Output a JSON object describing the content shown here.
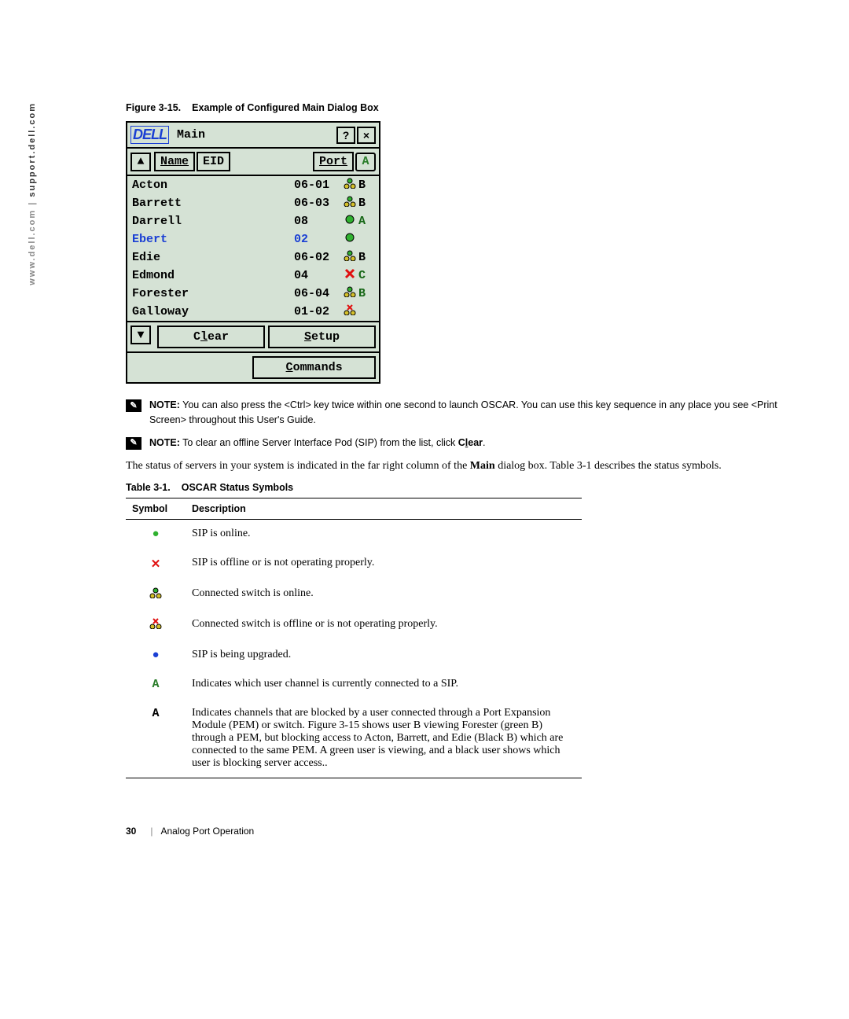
{
  "side_text_light": "www.dell.com | ",
  "side_text_dark": "support.dell.com",
  "fig_caption_num": "Figure 3-15.",
  "fig_caption_text": "Example of Configured Main Dialog Box",
  "dialog": {
    "logo": "DELL",
    "title": "Main",
    "help": "?",
    "close": "×",
    "hdr_name": "Name",
    "hdr_eid": "EID",
    "hdr_port": "Port",
    "hdr_a": "A",
    "rows": [
      {
        "name": "Acton",
        "port": "06-01",
        "icon": "switch-online",
        "icolor": "yellow",
        "ch": "B",
        "chcolor": "black"
      },
      {
        "name": "Barrett",
        "port": "06-03",
        "icon": "switch-online",
        "icolor": "yellow",
        "ch": "B",
        "chcolor": "black"
      },
      {
        "name": "Darrell",
        "port": "08",
        "icon": "circle",
        "icolor": "green",
        "ch": "A",
        "chcolor": "darkgreen"
      },
      {
        "name": "Ebert",
        "port": "02",
        "icon": "circle",
        "icolor": "green",
        "ch": "",
        "chcolor": "",
        "bold": true
      },
      {
        "name": "Edie",
        "port": "06-02",
        "icon": "switch-online",
        "icolor": "yellow",
        "ch": "B",
        "chcolor": "black"
      },
      {
        "name": "Edmond",
        "port": "04",
        "icon": "x",
        "icolor": "red",
        "ch": "C",
        "chcolor": "darkgreen"
      },
      {
        "name": "Forester",
        "port": "06-04",
        "icon": "switch-online",
        "icolor": "yellow",
        "ch": "B",
        "chcolor": "darkgreen"
      },
      {
        "name": "Galloway",
        "port": "01-02",
        "icon": "switch-offline",
        "icolor": "yellow",
        "ch": "",
        "chcolor": ""
      }
    ],
    "clear": "Clear",
    "setup": "Setup",
    "commands": "Commands"
  },
  "note1_label": "NOTE:",
  "note1_text": " You can also press the <Ctrl> key twice within one second to launch OSCAR. You can use this key sequence in any place you see <Print Screen> throughout this User's Guide.",
  "note2_label": "NOTE:",
  "note2_pre": " To clear an offline Server Interface Pod (SIP) from the list, click ",
  "note2_link": "Clear",
  "note2_post": ".",
  "body1": "The status of servers in your system is indicated in the far right column of the ",
  "body1_bold": "Main",
  "body1_post": " dialog box. Table 3-1 describes the status symbols.",
  "table_caption_num": "Table 3-1.",
  "table_caption_text": "OSCAR Status Symbols",
  "th_symbol": "Symbol",
  "th_desc": "Description",
  "rows": [
    {
      "sym": "●",
      "cls": "greenf",
      "desc": "SIP is online."
    },
    {
      "sym": "✕",
      "cls": "redf",
      "desc": "SIP is offline or is not operating properly."
    },
    {
      "sym": "switch-online",
      "cls": "",
      "desc": "Connected switch is online."
    },
    {
      "sym": "switch-offline",
      "cls": "",
      "desc": "Connected switch is offline or is not operating properly."
    },
    {
      "sym": "●",
      "cls": "bluef",
      "desc": "SIP is being upgraded."
    },
    {
      "sym": "A",
      "cls": "greenA",
      "desc": "Indicates which user channel is currently connected to a SIP."
    },
    {
      "sym": "A",
      "cls": "blackA",
      "desc": "Indicates channels that are blocked by a user connected through a Port Expansion Module (PEM) or switch. Figure 3-15 shows user B viewing Forester (green B) through a PEM, but blocking access to Acton, Barrett, and Edie (Black B) which are connected to the same PEM. A green user is viewing, and a black user shows which user is blocking server access.."
    }
  ],
  "footer_page": "30",
  "footer_text": "Analog Port Operation"
}
